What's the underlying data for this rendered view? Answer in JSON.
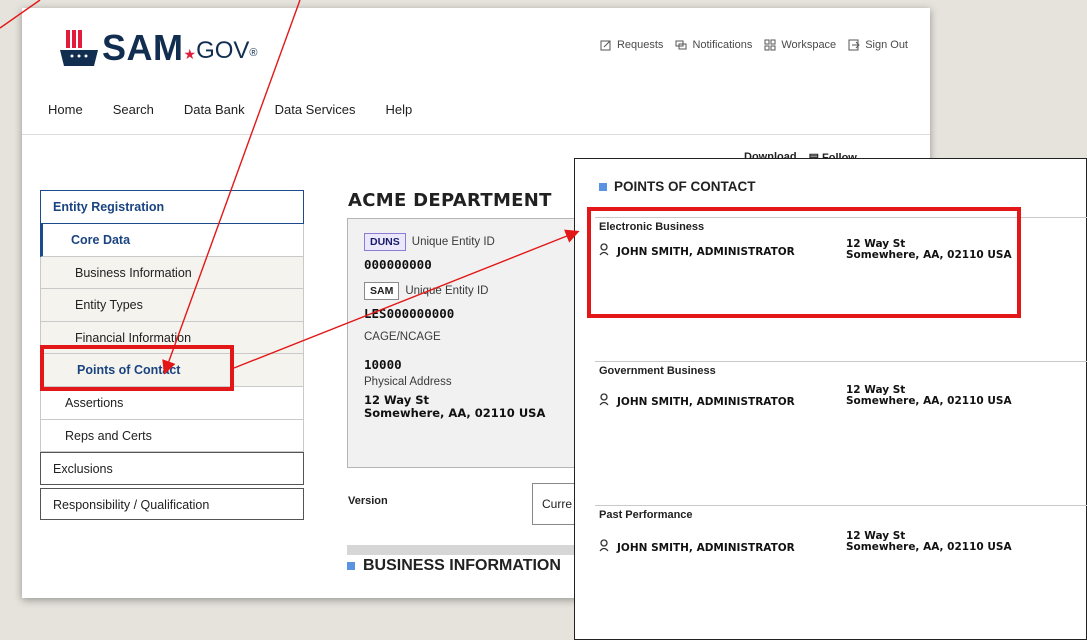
{
  "header": {
    "logo_text": "SAM",
    "logo_suffix": "GOV",
    "logo_reg": "®",
    "util": [
      {
        "label": "Requests",
        "icon": "edit-icon"
      },
      {
        "label": "Notifications",
        "icon": "chat-icon"
      },
      {
        "label": "Workspace",
        "icon": "grid-icon"
      },
      {
        "label": "Sign Out",
        "icon": "signout-icon"
      }
    ]
  },
  "nav": [
    "Home",
    "Search",
    "Data Bank",
    "Data Services",
    "Help"
  ],
  "sidebar": {
    "items": [
      "Entity Registration",
      "Core Data",
      "Business Information",
      "Entity Types",
      "Financial Information",
      "Points of Contact",
      "Assertions",
      "Reps and Certs",
      "Exclusions",
      "Responsibility / Qualification"
    ]
  },
  "toolbar": {
    "download": "Download",
    "follow": "Follow"
  },
  "entity": {
    "title": "ACME DEPARTMENT",
    "duns_tag": "DUNS",
    "duns_label": "Unique Entity ID",
    "duns_value": "000000000",
    "sam_tag": "SAM",
    "sam_label": "Unique Entity ID",
    "sam_value": "LES000000000",
    "cage_label": "CAGE/NCAGE",
    "cage_value": "10000",
    "addr_label": "Physical Address",
    "addr_line1": "12 Way St",
    "addr_line2": "Somewhere, AA, 02110 USA"
  },
  "version": {
    "label": "Version",
    "value": "Curre"
  },
  "section": {
    "business_info": "BUSINESS INFORMATION"
  },
  "overlay": {
    "title": "POINTS OF CONTACT",
    "groups": [
      {
        "name": "Electronic Business",
        "person": "JOHN SMITH, ADMINISTRATOR",
        "addr1": "12 Way St",
        "addr2": "Somewhere, AA, 02110 USA"
      },
      {
        "name": "Government Business",
        "person": "JOHN SMITH, ADMINISTRATOR",
        "addr1": "12 Way St",
        "addr2": "Somewhere, AA, 02110 USA"
      },
      {
        "name": "Past Performance",
        "person": "JOHN SMITH, ADMINISTRATOR",
        "addr1": "12 Way St",
        "addr2": "Somewhere, AA, 02110 USA"
      }
    ]
  },
  "colors": {
    "brand": "#112e51",
    "accent": "#1a4480",
    "highlight": "#e31717",
    "section_square": "#5b93e2"
  }
}
